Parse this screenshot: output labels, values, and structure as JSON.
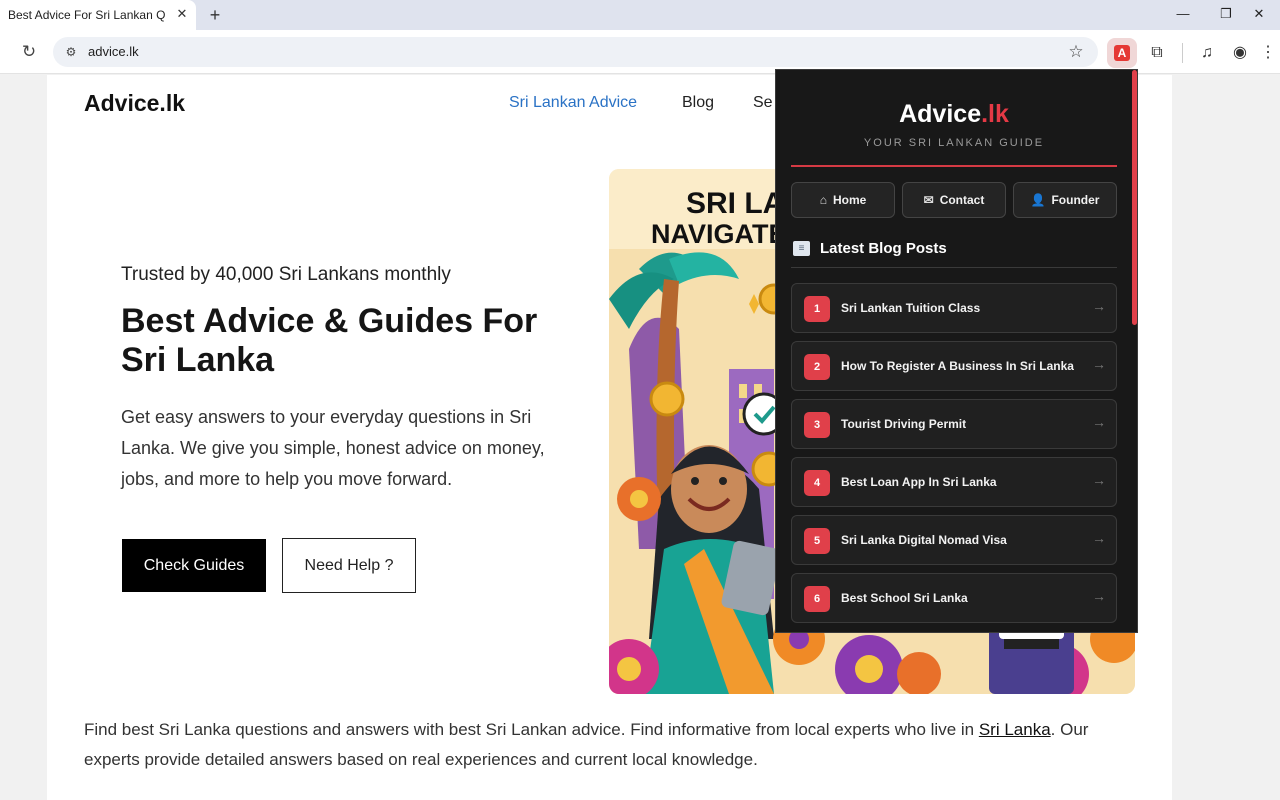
{
  "browser": {
    "tab_title": "Best Advice For Sri Lankan Que",
    "url": "advice.lk",
    "icons": {
      "tab_close": "close-icon",
      "new_tab": "plus-icon",
      "reload": "reload-icon",
      "site_info": "tune-icon",
      "bookmark": "star-icon",
      "extension": "advice-extension-icon",
      "extensions": "puzzle-icon",
      "media": "media-control-icon",
      "profile": "profile-icon",
      "menu": "kebab-menu-icon"
    },
    "glyphs": {
      "close": "✕",
      "plus": "+",
      "reload": "↻",
      "tune": "⚙",
      "star": "☆",
      "ext_a": "A",
      "puzzle": "⧉",
      "media": "♫",
      "profile": "◉",
      "menu": "⋮",
      "minimize": "—",
      "maximize": "❐"
    }
  },
  "site": {
    "logo": "Advice.lk",
    "nav": [
      "Sri Lankan Advice",
      "Blog",
      "Se"
    ],
    "hero": {
      "trusted": "Trusted by 40,000 Sri Lankans monthly",
      "title": "Best Advice & Guides For Sri Lanka",
      "description": "Get easy answers to your everyday questions in Sri Lanka. We give you simple, honest advice on money, jobs, and more to help you move forward.",
      "primary_button": "Check Guides",
      "secondary_button": "Need Help ?",
      "art_lines": [
        "SRI LA",
        "NAVIGATE"
      ]
    },
    "intro": {
      "before": "Find best Sri Lanka questions and answers with best Sri Lankan advice. Find informative from local experts who live in ",
      "link": "Sri Lanka",
      "after": ". Our experts provide detailed answers based on real experiences and current local knowledge."
    }
  },
  "popup": {
    "logo_main": "Advice",
    "logo_accent": ".lk",
    "subtitle": "YOUR SRI LANKAN GUIDE",
    "buttons": [
      {
        "label": "Home",
        "icon": "home-icon",
        "glyph": "⌂"
      },
      {
        "label": "Contact",
        "icon": "mail-icon",
        "glyph": "✉"
      },
      {
        "label": "Founder",
        "icon": "user-icon",
        "glyph": "👤"
      }
    ],
    "heading": "Latest Blog Posts",
    "heading_icon": "newspaper-icon",
    "posts": [
      {
        "num": "1",
        "title": "Sri Lankan Tuition Class"
      },
      {
        "num": "2",
        "title": "How To Register A Business In Sri Lanka"
      },
      {
        "num": "3",
        "title": "Tourist Driving Permit"
      },
      {
        "num": "4",
        "title": "Best Loan App In Sri Lanka"
      },
      {
        "num": "5",
        "title": "Sri Lanka Digital Nomad Visa"
      },
      {
        "num": "6",
        "title": "Best School Sri Lanka"
      }
    ],
    "arrow": "→"
  },
  "colors": {
    "accent_red": "#e0404a",
    "nav_active": "#2a72c5",
    "popup_bg": "#181818"
  }
}
